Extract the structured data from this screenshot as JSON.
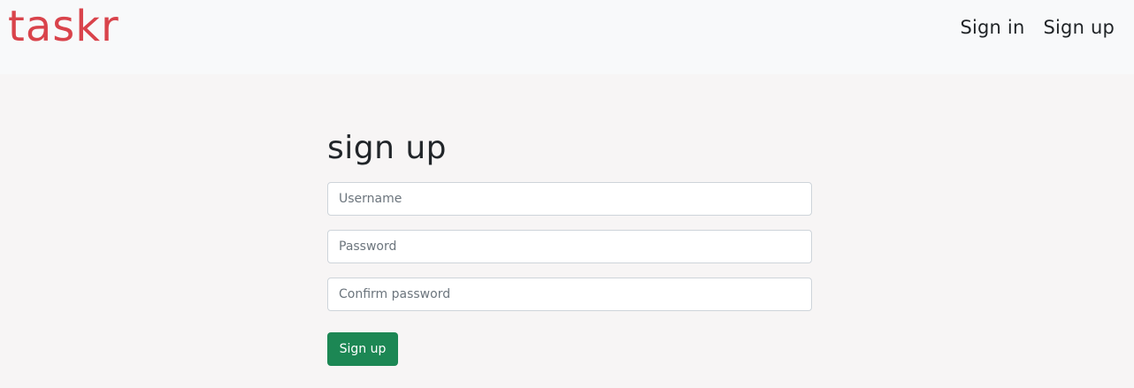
{
  "header": {
    "brand": "taskr",
    "nav": [
      {
        "label": "Sign in"
      },
      {
        "label": "Sign up"
      }
    ]
  },
  "form": {
    "title": "sign up",
    "username_placeholder": "Username",
    "password_placeholder": "Password",
    "confirm_placeholder": "Confirm password",
    "submit_label": "Sign up"
  },
  "colors": {
    "brand": "#d9434b",
    "primary_button": "#1c8754",
    "header_bg": "#f8f9fa",
    "page_bg": "#f7f5f5"
  }
}
